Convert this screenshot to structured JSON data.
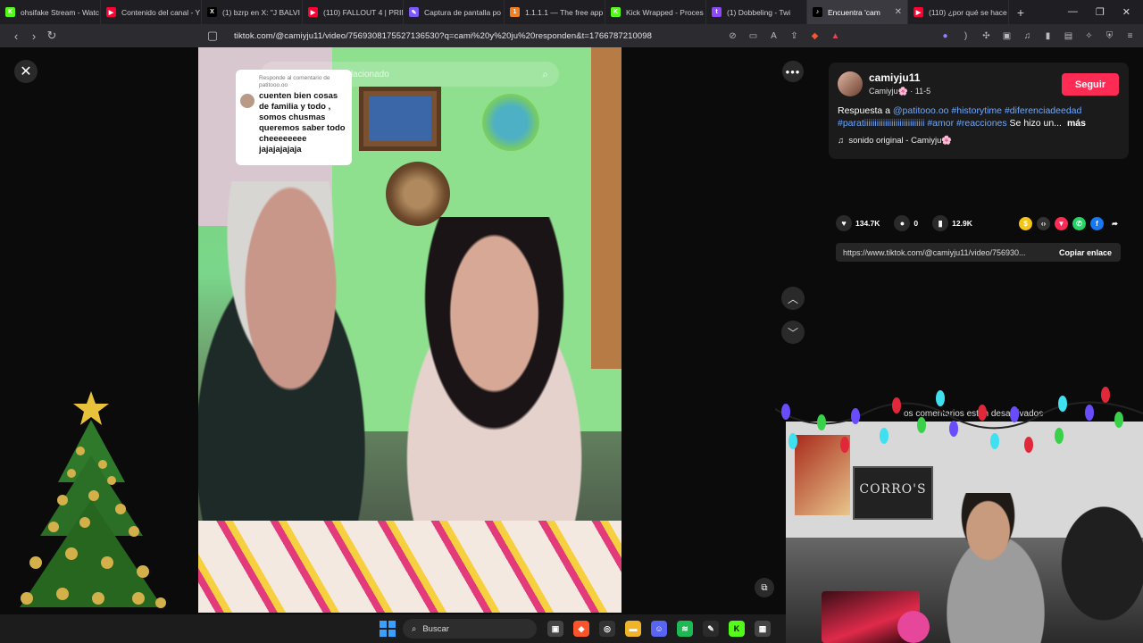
{
  "browser": {
    "tabs": [
      {
        "title": "ohsifake Stream - Watc",
        "icon_color": "#53fc18",
        "icon_glyph": "K"
      },
      {
        "title": "Contenido del canal - Y",
        "icon_color": "#ff0033",
        "icon_glyph": "▶"
      },
      {
        "title": "(1) bzrp en X: \"J BALVI",
        "icon_color": "#000000",
        "icon_glyph": "X"
      },
      {
        "title": "(110) FALLOUT 4 | PRIM",
        "icon_color": "#ff0033",
        "icon_glyph": "▶"
      },
      {
        "title": "Captura de pantalla po",
        "icon_color": "#7a5af8",
        "icon_glyph": "✎"
      },
      {
        "title": "1.1.1.1 — The free app",
        "icon_color": "#f38020",
        "icon_glyph": "1"
      },
      {
        "title": "Kick Wrapped - Proces",
        "icon_color": "#53fc18",
        "icon_glyph": "K"
      },
      {
        "title": "(1) Dobbeling - Twi",
        "icon_color": "#9146ff",
        "icon_glyph": "t"
      },
      {
        "title": "Encuentra 'cam",
        "icon_color": "#000000",
        "icon_glyph": "♪",
        "active": true
      },
      {
        "title": "(110) ¿por qué se hace",
        "icon_color": "#ff0033",
        "icon_glyph": "▶"
      }
    ],
    "url": "tiktok.com/@camiyju11/video/7569308175527136530?q=cami%20y%20ju%20responden&t=1766787210098"
  },
  "video": {
    "search_placeholder": "Buscar contenido relacionado",
    "reply_label": "Responde al comentario de patitooo.oo",
    "reply_text": "cuenten bien cosas de familia y todo , somos chusmas queremos saber todo cheeeeeeee jajajajajaja"
  },
  "post": {
    "username": "camiyju11",
    "display_name": "Camiyju🌸",
    "date": "· 11-5",
    "follow_label": "Seguir",
    "desc_prefix": "Respuesta a ",
    "mention": "@patitooo.oo",
    "tags": "#historytime #diferenciadeedad #paratiiiiiiiiiiiiiiiiiiiiiiiiiiiii #amor #reacciones",
    "desc_suffix": " Se hizo un...",
    "more_label": "más",
    "sound": "sonido original - Camiyju🌸",
    "likes": "134.7K",
    "comments": "0",
    "saves": "12.9K",
    "link": "https://www.tiktok.com/@camiyju11/video/756930...",
    "copy_label": "Copiar enlace",
    "comments_off": "os comentarios están desactivados"
  },
  "webcam": {
    "poster_text": "CORRO'S"
  },
  "taskbar": {
    "search_label": "Buscar"
  },
  "colors": {
    "follow": "#fe2c55",
    "hashtag": "#6fa8ff"
  }
}
